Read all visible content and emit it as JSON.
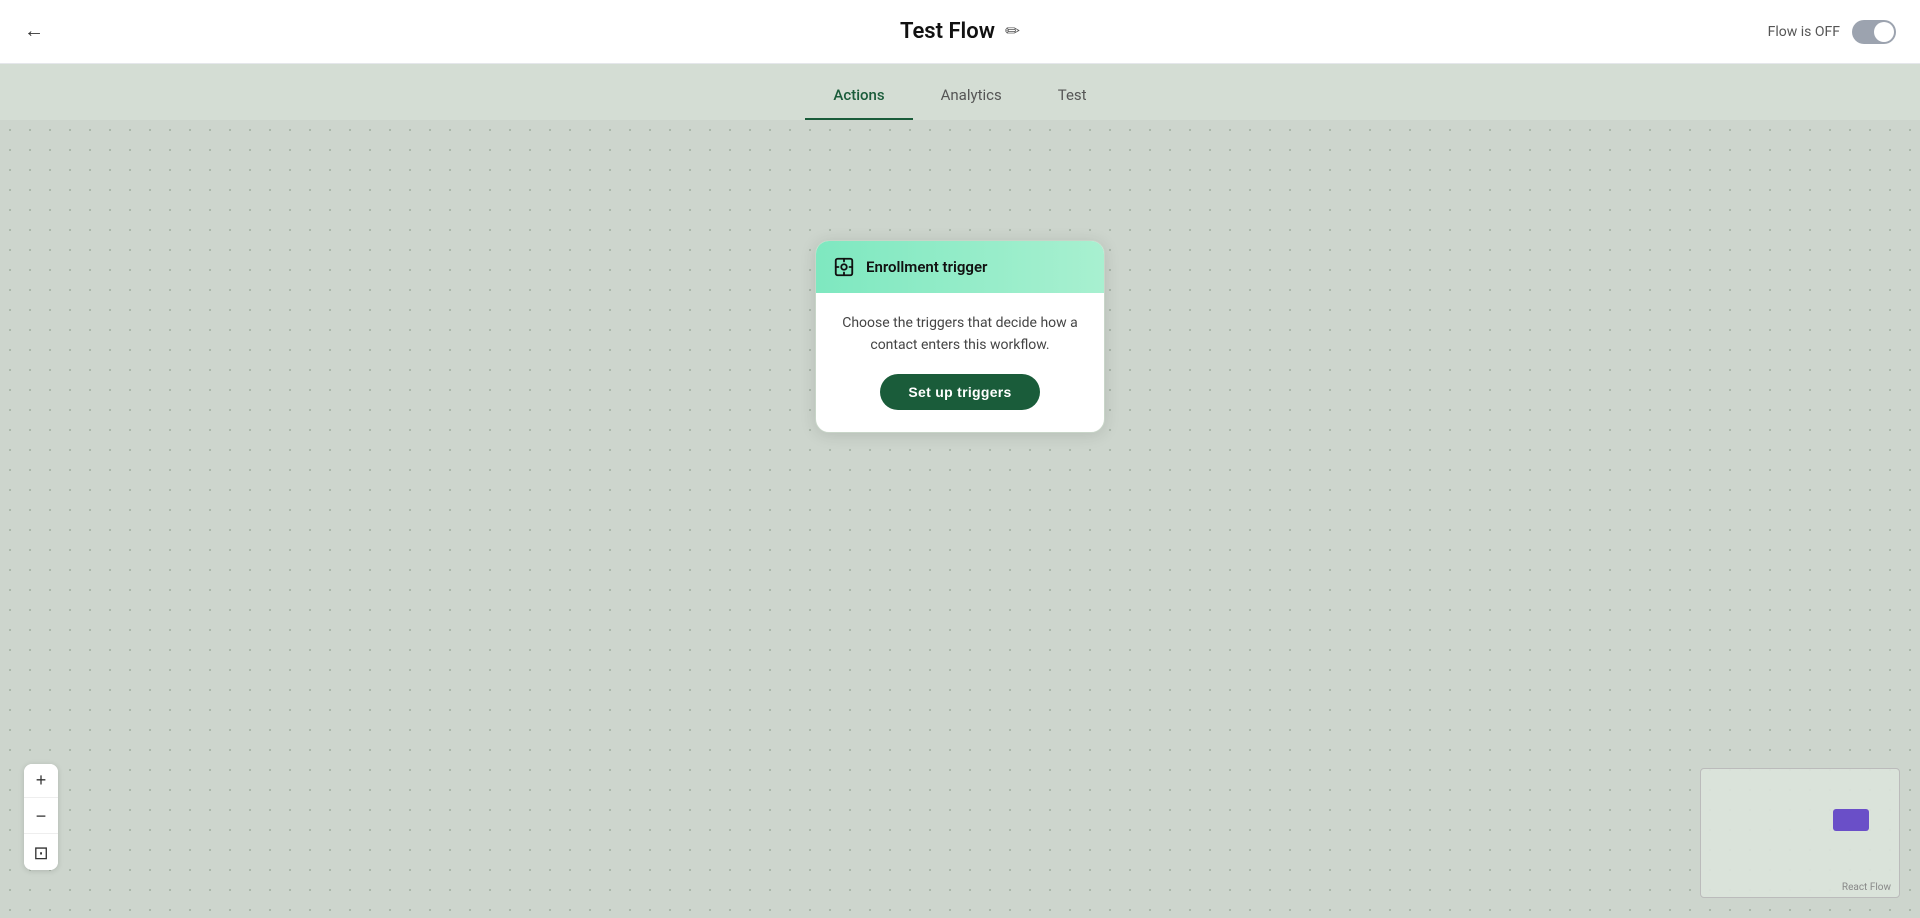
{
  "header": {
    "back_label": "←",
    "title": "Test Flow",
    "edit_icon": "✏",
    "flow_status_label": "Flow is OFF"
  },
  "tabs": [
    {
      "id": "actions",
      "label": "Actions",
      "active": true
    },
    {
      "id": "analytics",
      "label": "Analytics",
      "active": false
    },
    {
      "id": "test",
      "label": "Test",
      "active": false
    }
  ],
  "canvas": {
    "enrollment_card": {
      "header_title": "Enrollment trigger",
      "description": "Choose the triggers that decide how a contact enters this workflow.",
      "button_label": "Set up triggers"
    }
  },
  "zoom_controls": {
    "zoom_in": "+",
    "zoom_out": "−",
    "fit": "⊡"
  },
  "react_flow_label": "React Flow"
}
